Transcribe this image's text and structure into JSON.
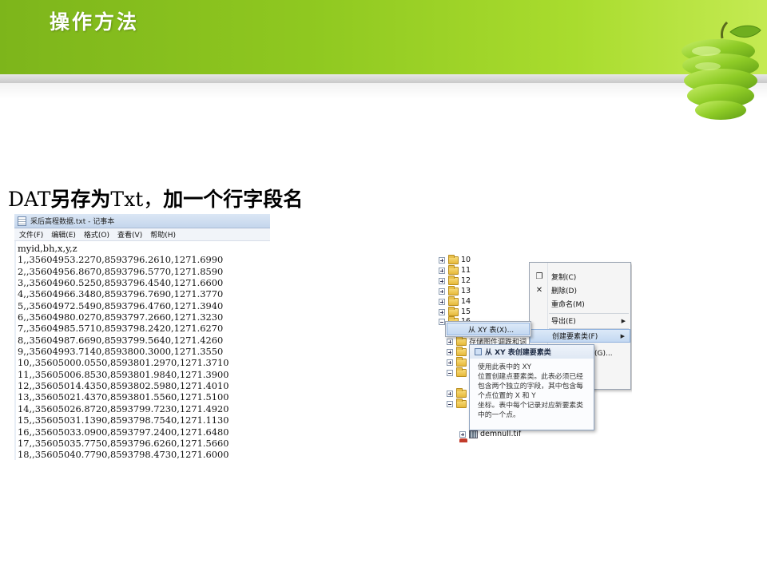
{
  "slide": {
    "title": "操作方法",
    "instruction_latin_1": "DAT",
    "instruction_cjk_1": "另存为",
    "instruction_latin_2": "Txt，",
    "instruction_cjk_2": "加一个行字段名"
  },
  "colors": {
    "header_green": "#8fc820",
    "apple_green": "#9bd12c",
    "menu_highlight": "#c3d8f1"
  },
  "notepad": {
    "title": "采后高程数据.txt - 记事本",
    "menu": [
      "文件(F)",
      "编辑(E)",
      "格式(O)",
      "查看(V)",
      "帮助(H)"
    ],
    "lines": [
      "myid,bh,x,y,z",
      "1,,35604953.2270,8593796.2610,1271.6990",
      "2,,35604956.8670,8593796.5770,1271.8590",
      "3,,35604960.5250,8593796.4540,1271.6600",
      "4,,35604966.3480,8593796.7690,1271.3770",
      "5,,35604972.5490,8593796.4760,1271.3940",
      "6,,35604980.0270,8593797.2660,1271.3230",
      "7,,35604985.5710,8593798.2420,1271.6270",
      "8,,35604987.6690,8593799.5640,1271.4260",
      "9,,35604993.7140,8593800.3000,1271.3550",
      "10,,35605000.0550,8593801.2970,1271.3710",
      "11,,35605006.8530,8593801.9840,1271.3900",
      "12,,35605014.4350,8593802.5980,1271.4010",
      "13,,35605021.4370,8593801.5560,1271.5100",
      "14,,35605026.8720,8593799.7230,1271.4920",
      "15,,35605031.1390,8593798.7540,1271.1130",
      "16,,35605033.0900,8593797.2400,1271.6480",
      "17,,35605035.7750,8593796.6260,1271.5660",
      "18,,35605040.7790,8593798.4730,1271.6000"
    ]
  },
  "catalog": {
    "tree_items": [
      "10",
      "11",
      "12",
      "13",
      "14",
      "15",
      "16"
    ],
    "tree_fragment": "存储图件调跌和词",
    "file_item": "demnull.tif",
    "context_menu": {
      "items": [
        {
          "label": "复制(C)",
          "icon": "copy-icon"
        },
        {
          "label": "删除(D)",
          "icon": "delete-icon"
        },
        {
          "label": "重命名(M)",
          "icon": ""
        },
        {
          "label": "导出(E)",
          "icon": "",
          "submenu": true
        },
        {
          "label": "创建要素类(F)",
          "icon": "",
          "submenu": true,
          "active": true
        },
        {
          "label": "批理循环地址(G)...",
          "icon": "geocode-icon"
        }
      ]
    },
    "submenu_item": "从 XY 表(X)...",
    "tooltip": {
      "title": "从 XY 表创建要素类",
      "lines": [
        "使用此表中的 XY",
        "位置创建点要素类。此表必须已经",
        "包含两个独立的字段，其中包含每",
        "个点位置的 X 和 Y",
        "坐标。表中每个记录对应新要素类",
        "中的一个点。"
      ]
    }
  }
}
